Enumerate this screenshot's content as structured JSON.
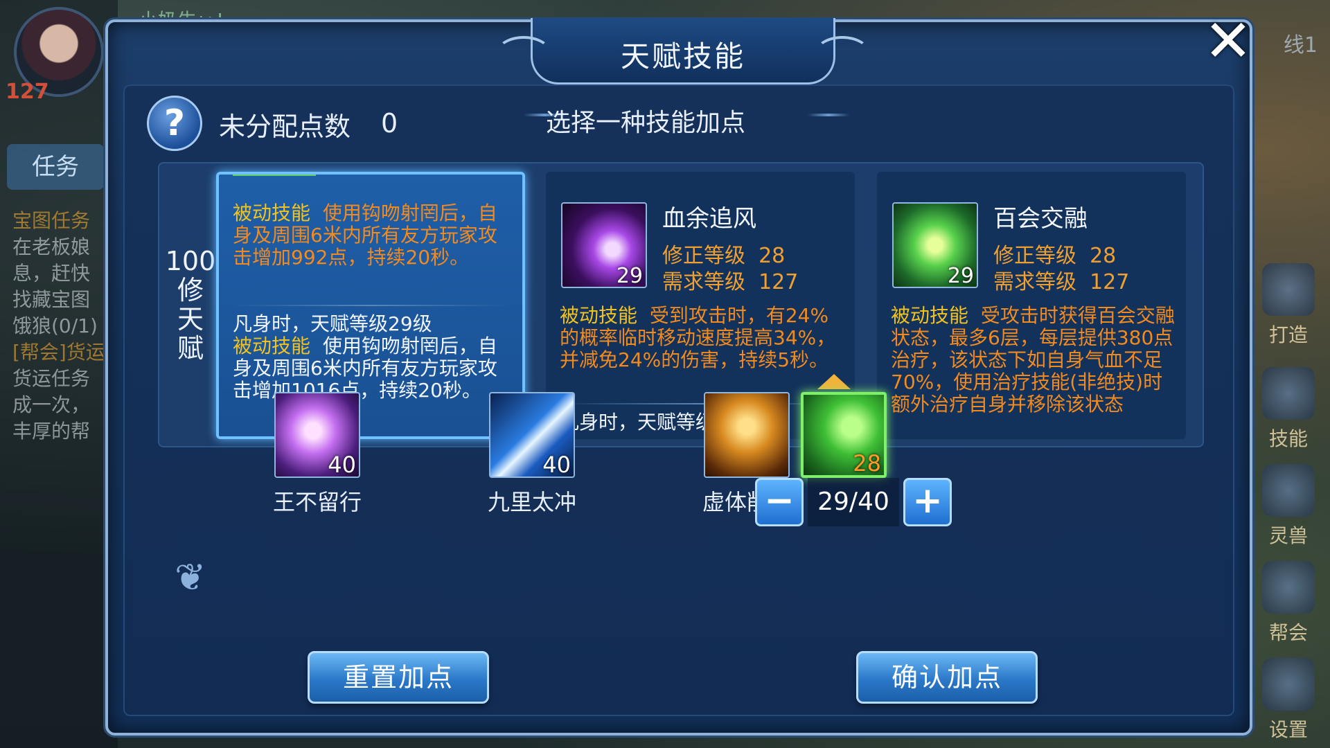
{
  "background": {
    "player_name": "小奶牛ぃ!",
    "player_level": "127",
    "task_tab": "任务",
    "task_lines": [
      "宝图任务",
      "在老板娘",
      "息，赶快",
      "找藏宝图",
      "饿狼(0/1)",
      "[帮会]货运",
      "货运任务",
      "成一次，",
      "丰厚的帮"
    ],
    "server_line": "线1",
    "right_menu": [
      "打造",
      "技能",
      "灵兽",
      "帮会",
      "设置"
    ]
  },
  "dialog": {
    "title": "天赋技能",
    "close_icon": "close-icon",
    "help_icon": "question-icon",
    "unassigned_label": "未分配点数",
    "unassigned_value": "0",
    "choose_hint": "选择一种技能加点"
  },
  "talent_tier": {
    "label_lines": [
      "100",
      "修",
      "天",
      "赋"
    ]
  },
  "cards": [
    {
      "selected": true,
      "desc_tag": "被动技能",
      "desc": "使用钩吻射罔后，自身及周围6米内所有友方玩家攻击增加992点，持续20秒。",
      "next_level_title": "凡身时，天赋等级29级",
      "next_tag": "被动技能",
      "next_desc": "使用钩吻射罔后，自身及周围6米内所有友方玩家攻击增加1016点，持续20秒。"
    },
    {
      "selected": false,
      "name": "血余追风",
      "icon_level": "29",
      "fix_level_label": "修正等级",
      "fix_level": "28",
      "req_level_label": "需求等级",
      "req_level": "127",
      "desc_tag": "被动技能",
      "desc": "受到攻击时，有24%的概率临时移动速度提高34%，并减免24%的伤害，持续5秒。",
      "next_level_title": "凡身时，天赋等级29级"
    },
    {
      "selected": false,
      "name": "百会交融",
      "icon_level": "29",
      "fix_level_label": "修正等级",
      "fix_level": "28",
      "req_level_label": "需求等级",
      "req_level": "127",
      "desc_tag": "被动技能",
      "desc": "受攻击时获得百会交融状态，最多6层，每层提供380点治疗，该状态下如自身气血不足70%，使用治疗技能(非绝技)时额外治疗自身并移除该状态"
    }
  ],
  "skills": [
    {
      "name": "王不留行",
      "level": "40",
      "icon": "lightning-hand-icon"
    },
    {
      "name": "九里太冲",
      "level": "40",
      "icon": "light-beam-icon"
    },
    {
      "name": "虚体削骨",
      "level": "",
      "icon": "crouching-figure-icon"
    },
    {
      "name": "",
      "level": "28",
      "icon": "green-stones-icon"
    }
  ],
  "stepper": {
    "minus": "−",
    "value": "29/40",
    "plus": "+"
  },
  "footer": {
    "reset_label": "重置加点",
    "confirm_label": "确认加点"
  }
}
